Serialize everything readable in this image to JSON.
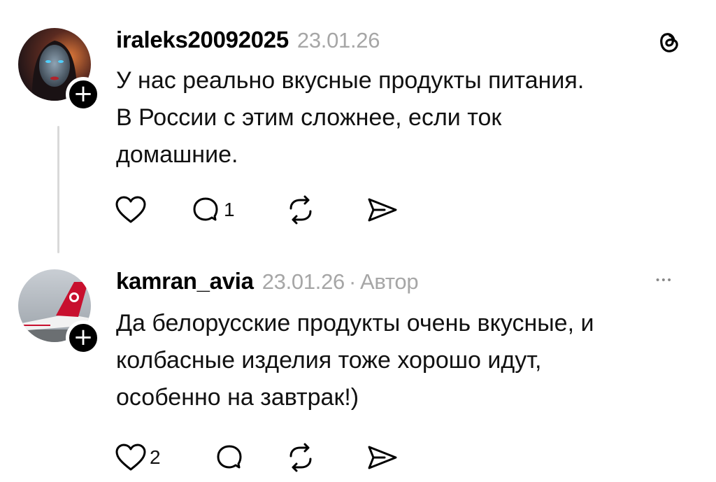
{
  "comments": [
    {
      "username": "iraleks20092025",
      "date": "23.01.26",
      "author_badge": "",
      "text_lines": [
        "У нас реально вкусные продукты питания.",
        "В России с этим сложнее, если ток",
        "домашние."
      ],
      "likes": "",
      "replies": "1"
    },
    {
      "username": "kamran_avia",
      "date": "23.01.26",
      "author_badge": "Автор",
      "separator": "·",
      "text_lines": [
        "Да белорусские продукты очень вкусные, и",
        "колбасные изделия тоже хорошо идут,",
        "особенно на завтрак!)"
      ],
      "likes": "2",
      "replies": ""
    }
  ],
  "icons": {
    "top_right_first": "threads-logo-icon",
    "top_right_second": "more-options-icon",
    "follow": "+",
    "more": "•••"
  },
  "colors": {
    "meta": "#a6a6a6",
    "thread_line": "#d9d9d9",
    "text": "#111111"
  }
}
